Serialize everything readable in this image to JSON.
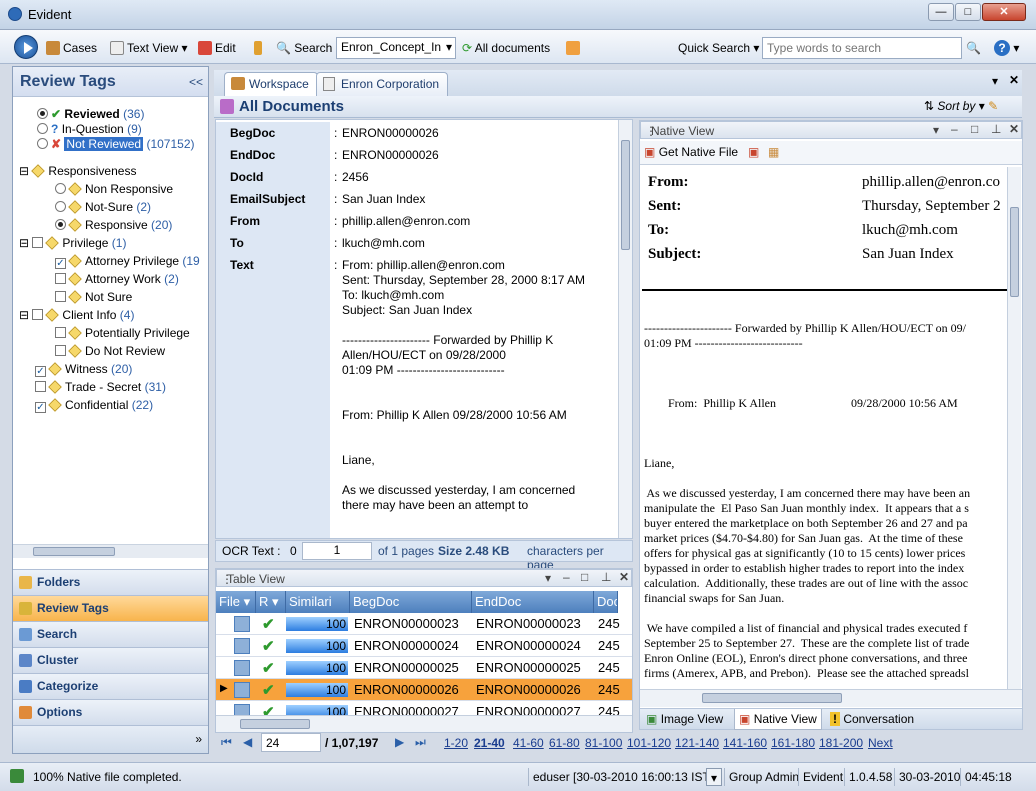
{
  "window": {
    "title": "Evident"
  },
  "toolbar": {
    "cases": "Cases",
    "text_view": "Text View",
    "edit": "Edit",
    "search": "Search",
    "concept_combo": "Enron_Concept_In",
    "all_documents": "All documents",
    "quick_search": "Quick Search",
    "quick_search_placeholder": "Type words to search"
  },
  "left": {
    "title": "Review Tags",
    "collapse": "<<",
    "reviewed": "Reviewed",
    "reviewed_count": "(36)",
    "inquestion": "In-Question",
    "inquestion_count": "(9)",
    "notreviewed": "Not Reviewed",
    "notreviewed_count": "(107152)",
    "responsiveness": "Responsiveness",
    "nonresponsive": "Non Responsive",
    "notsure": "Not-Sure",
    "notsure_count": "(2)",
    "responsive": "Responsive",
    "responsive_count": "(20)",
    "privilege": "Privilege",
    "privilege_count": "(1)",
    "attorney_priv": "Attorney Privilege",
    "attorney_priv_count": "(19",
    "attorney_work": "Attorney Work",
    "attorney_work_count": "(2)",
    "not_sure2": "Not Sure",
    "client_info": "Client Info",
    "client_info_count": "(4)",
    "pot_priv": "Potentially Privilege",
    "do_not_review": "Do Not Review",
    "witness": "Witness",
    "witness_count": "(20)",
    "trade_secret": "Trade - Secret",
    "trade_secret_count": "(31)",
    "confidential": "Confidential",
    "confidential_count": "(22)"
  },
  "nav": [
    "Folders",
    "Review Tags",
    "Search",
    "Cluster",
    "Categorize",
    "Options"
  ],
  "tabs": {
    "workspace": "Workspace",
    "enron": "Enron Corporation"
  },
  "docs": {
    "title": "All Documents",
    "sort_by": "Sort by"
  },
  "fields": {
    "begdoc_l": "BegDoc",
    "begdoc_v": "ENRON00000026",
    "enddoc_l": "EndDoc",
    "enddoc_v": "ENRON00000026",
    "docid_l": "DocId",
    "docid_v": "2456",
    "subject_l": "EmailSubject",
    "subject_v": "San Juan Index",
    "from_l": "From",
    "from_v": "phillip.allen@enron.com",
    "to_l": "To",
    "to_v": "lkuch@mh.com",
    "text_l": "Text",
    "text_v": "From: phillip.allen@enron.com\nSent: Thursday, September 28, 2000 8:17 AM\nTo: lkuch@mh.com\nSubject: San Juan Index\n\n---------------------- Forwarded by Phillip K\nAllen/HOU/ECT on 09/28/2000\n01:09 PM ---------------------------\n\n\nFrom: Phillip K Allen 09/28/2000 10:56 AM\n\n\nLiane,\n\nAs we discussed yesterday, I am concerned\nthere may have been an attempt to",
    "colon": ":"
  },
  "ocr": {
    "label": "OCR Text :",
    "zero": "0",
    "page": "1",
    "of_pages": "of 1 pages",
    "size": "Size 2.48 KB",
    "cpp": "characters per page"
  },
  "table": {
    "title": "Table View",
    "headers": [
      "File",
      "R",
      "Similari",
      "BegDoc",
      "EndDoc",
      "Doc"
    ],
    "rows": [
      {
        "sim": "100",
        "beg": "ENRON00000023",
        "end": "ENRON00000023",
        "doc": "245"
      },
      {
        "sim": "100",
        "beg": "ENRON00000024",
        "end": "ENRON00000024",
        "doc": "245"
      },
      {
        "sim": "100",
        "beg": "ENRON00000025",
        "end": "ENRON00000025",
        "doc": "245"
      },
      {
        "sim": "100",
        "beg": "ENRON00000026",
        "end": "ENRON00000026",
        "doc": "245"
      },
      {
        "sim": "100",
        "beg": "ENRON00000027",
        "end": "ENRON00000027",
        "doc": "245"
      }
    ]
  },
  "pager": {
    "page": "24",
    "total": "/ 1,07,197",
    "links": [
      "1-20",
      "21-40",
      "41-60",
      "61-80",
      "81-100",
      "101-120",
      "121-140",
      "141-160",
      "161-180",
      "181-200"
    ],
    "next": "Next"
  },
  "native": {
    "title": "Native View",
    "get_native": "Get Native File",
    "from_l": "From:",
    "from_v": "phillip.allen@enron.co",
    "sent_l": "Sent:",
    "sent_v": "Thursday, September 2",
    "to_l": "To:",
    "to_v": "lkuch@mh.com",
    "subject_l": "Subject:",
    "subject_v": "San Juan Index",
    "body": "---------------------- Forwarded by Phillip K Allen/HOU/ECT on 09/\n01:09 PM ---------------------------\n\n\n\n        From:  Phillip K Allen                         09/28/2000 10:56 AM\n\n\n\nLiane,\n\n As we discussed yesterday, I am concerned there may have been an\nmanipulate the  El Paso San Juan monthly index.  It appears that a s\nbuyer entered the marketplace on both September 26 and 27 and pa\nmarket prices ($4.70-$4.80) for San Juan gas.  At the time of these \noffers for physical gas at significantly (10 to 15 cents) lower prices \nbypassed in order to establish higher trades to report into the index \ncalculation.  Additionally, these trades are out of line with the assoc\nfinancial swaps for San Juan.\n\n We have compiled a list of financial and physical trades executed f\nSeptember 25 to September 27.  These are the complete list of trade\nEnron Online (EOL), Enron's direct phone conversations, and three\nfirms (Amerex, APB, and Prebon).  Please see the attached spreadsl"
  },
  "bottom_tabs": [
    "Image View",
    "Native View",
    "Conversation"
  ],
  "status": {
    "msg": "100% Native file completed.",
    "user": "eduser [30-03-2010 16:00:13 IST]",
    "role": "Group Admin",
    "app": "Evident",
    "version": "1.0.4.58",
    "date": "30-03-2010",
    "time": "04:45:18"
  }
}
